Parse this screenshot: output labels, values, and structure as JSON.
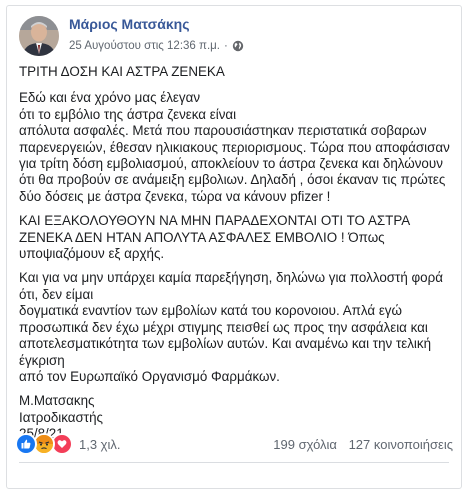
{
  "post": {
    "author": "Μάριος Ματσάκης",
    "timestamp": "25 Αυγούστου στις 12:36 π.μ.",
    "privacy_icon": "globe-icon",
    "title": "ΤΡΙΤΗ ΔΟΣΗ ΚΑΙ ΑΣΤΡΑ ΖΕΝΕΚΑ",
    "paragraph1": [
      "Εδώ και ένα χρόνο μας έλεγαν",
      "ότι το εμβόλιο της άστρα ζενεκα είναι",
      "απόλυτα ασφαλές. Μετά που παρουσιάστηκαν περιστατικά σοβαρων παρενεργειών, έθεσαν ηλικιακους περιορισμους. Τώρα που αποφάσισαν για τρίτη δόση εμβολιασμού, αποκλείουν το άστρα ζενεκα και δηλώνουν ότι θα προβούν σε ανάμειξη εμβολιων. Δηλαδή , όσοι έκαναν τις πρώτες δύο δόσεις με άστρα ζενεκα, τώρα να κάνουν pfizer !"
    ],
    "paragraph2": "ΚΑΙ ΕΞΑΚΟΛΟΥΘΟΥΝ ΝΑ ΜΗΝ ΠΑΡΑΔΕΧΟΝΤΑΙ ΟΤΙ ΤΟ ΑΣΤΡΑ ΖΕΝΕΚΑ ΔΕΝ ΗΤΑΝ ΑΠΟΛΥΤΑ ΑΣΦΑΛΕΣ ΕΜΒΟΛΙΟ ! Όπως υποψιαζόμουν εξ αρχής.",
    "paragraph3": [
      "Και για να μην υπάρχει καμία παρεξήγηση, δηλώνω για πολλοστή φορά ότι, δεν είμαι",
      "δογματικά εναντίον των εμβολίων κατά του κορονοιου. Απλά εγώ προσωπικά δεν έχω μέχρι στιγμης πεισθεί ως προς την ασφάλεια και αποτελεσματικότητα των εμβολίων αυτών. Και αναμένω και την τελική έγκριση",
      "από τον Ευρωπαϊκό Οργανισμό Φαρμάκων."
    ],
    "signature": [
      "Μ.Ματσακης",
      "Ιατροδικαστής",
      "25/8/21"
    ]
  },
  "footer": {
    "reaction_icons": [
      "like-icon",
      "angry-icon",
      "love-icon"
    ],
    "reaction_colors": [
      "#1877f2",
      "#f7b125",
      "#f33e58"
    ],
    "reaction_count": "1,3 χιλ.",
    "comments": "199 σχόλια",
    "shares": "127 κοινοποιήσεις"
  }
}
